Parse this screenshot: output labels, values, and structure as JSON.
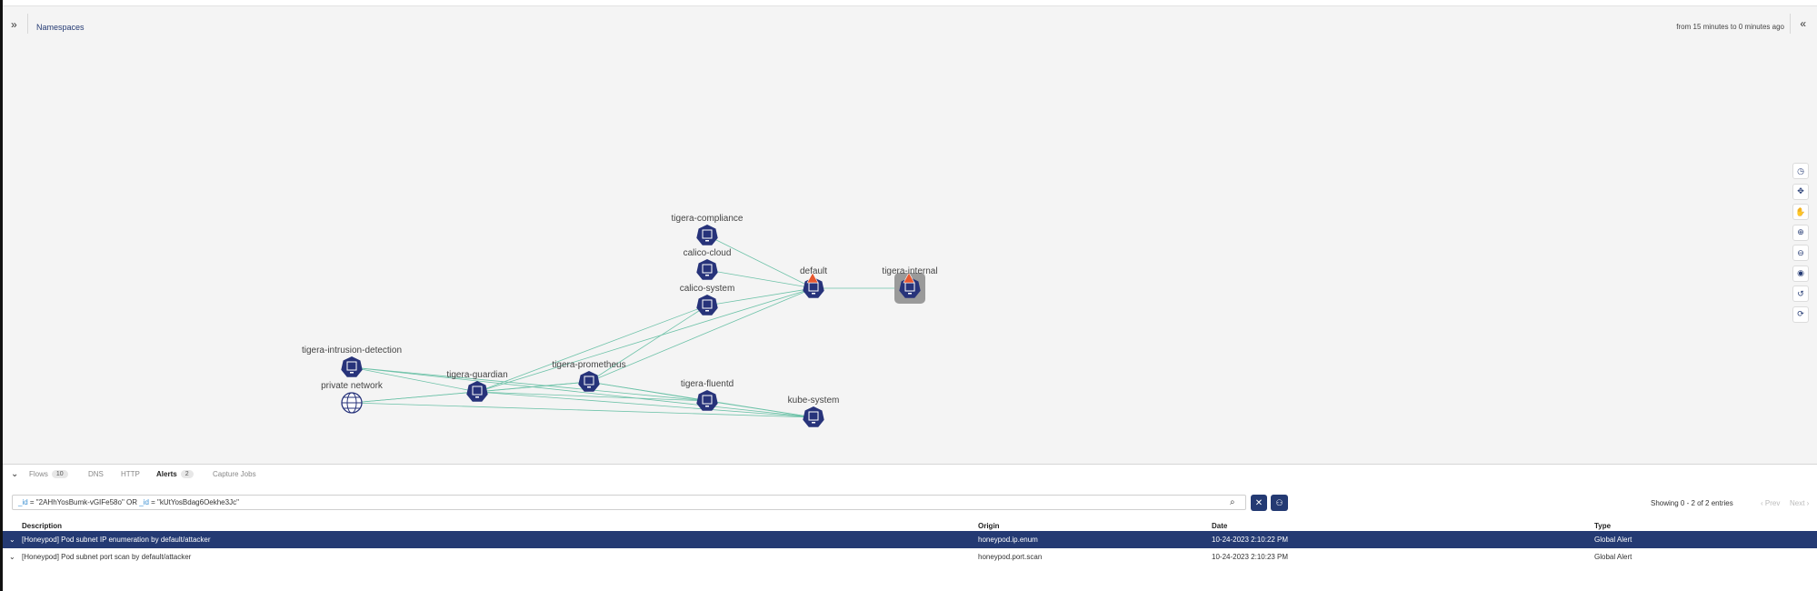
{
  "header": {
    "breadcrumb": "Namespaces",
    "time_range": "from 15 minutes to 0 minutes ago"
  },
  "graph": {
    "node_color": "#27337a",
    "edge_color": "#6dc2a8",
    "nodes": [
      {
        "id": "tigera-compliance",
        "label": "tigera-compliance",
        "icon": "namespace-icon"
      },
      {
        "id": "calico-cloud",
        "label": "calico-cloud",
        "icon": "namespace-icon"
      },
      {
        "id": "calico-system",
        "label": "calico-system",
        "icon": "namespace-icon"
      },
      {
        "id": "default",
        "label": "default",
        "icon": "namespace-icon",
        "alert": true
      },
      {
        "id": "tigera-internal",
        "label": "tigera-internal",
        "icon": "namespace-icon",
        "alert": true,
        "selected": true
      },
      {
        "id": "tigera-intrusion-detection",
        "label": "tigera-intrusion-detection",
        "icon": "namespace-icon"
      },
      {
        "id": "private-network",
        "label": "private network",
        "icon": "globe-icon"
      },
      {
        "id": "tigera-guardian",
        "label": "tigera-guardian",
        "icon": "namespace-icon"
      },
      {
        "id": "tigera-prometheus",
        "label": "tigera-prometheus",
        "icon": "namespace-icon"
      },
      {
        "id": "tigera-fluentd",
        "label": "tigera-fluentd",
        "icon": "namespace-icon"
      },
      {
        "id": "kube-system",
        "label": "kube-system",
        "icon": "namespace-icon"
      }
    ]
  },
  "toolbar": {
    "tools": [
      "history-icon",
      "fit-icon",
      "pan-icon",
      "zoom-in-icon",
      "zoom-out-icon",
      "view-icon",
      "undo-icon",
      "refresh-icon"
    ]
  },
  "tabs": [
    {
      "label": "Flows",
      "count": "10"
    },
    {
      "label": "DNS"
    },
    {
      "label": "HTTP"
    },
    {
      "label": "Alerts",
      "count": "2",
      "active": true
    },
    {
      "label": "Capture Jobs"
    }
  ],
  "search": {
    "key1": "_id",
    "value1": " = \"2AHhYosBumk-vGIFe58o\" OR ",
    "key2": "_id",
    "value2": " = \"kUtYosBdag6Oekhe3Jc\""
  },
  "pagination": {
    "showing": "Showing 0 - 2 of 2 entries",
    "prev": "‹ Prev",
    "next": "Next ›"
  },
  "table": {
    "columns": [
      "Description",
      "Origin",
      "Date",
      "Type"
    ],
    "rows": [
      {
        "description": "[Honeypod] Pod subnet IP enumeration by default/attacker",
        "origin": "honeypod.ip.enum",
        "date": "10-24-2023 2:10:22 PM",
        "type": "Global Alert",
        "selected": true
      },
      {
        "description": "[Honeypod] Pod subnet port scan by default/attacker",
        "origin": "honeypod.port.scan",
        "date": "10-24-2023 2:10:23 PM",
        "type": "Global Alert"
      }
    ]
  }
}
